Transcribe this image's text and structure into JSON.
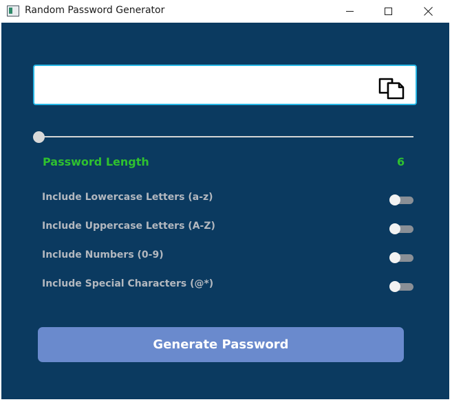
{
  "window": {
    "title": "Random Password Generator"
  },
  "password": {
    "value": ""
  },
  "length": {
    "label": "Password Length",
    "value": "6"
  },
  "options": [
    {
      "label": "Include Lowercase Letters (a-z)",
      "enabled": false
    },
    {
      "label": "Include Uppercase Letters (A-Z)",
      "enabled": false
    },
    {
      "label": "Include Numbers (0-9)",
      "enabled": false
    },
    {
      "label": "Include Special Characters (@*)",
      "enabled": false
    }
  ],
  "generate_button": {
    "label": "Generate Password"
  },
  "colors": {
    "background": "#0b3a60",
    "accent_green": "#2fc12f",
    "button": "#6a8acd",
    "field_border": "#27b7e6"
  },
  "icons": [
    "app-icon",
    "minimize-icon",
    "maximize-icon",
    "close-icon",
    "copy-icon"
  ]
}
